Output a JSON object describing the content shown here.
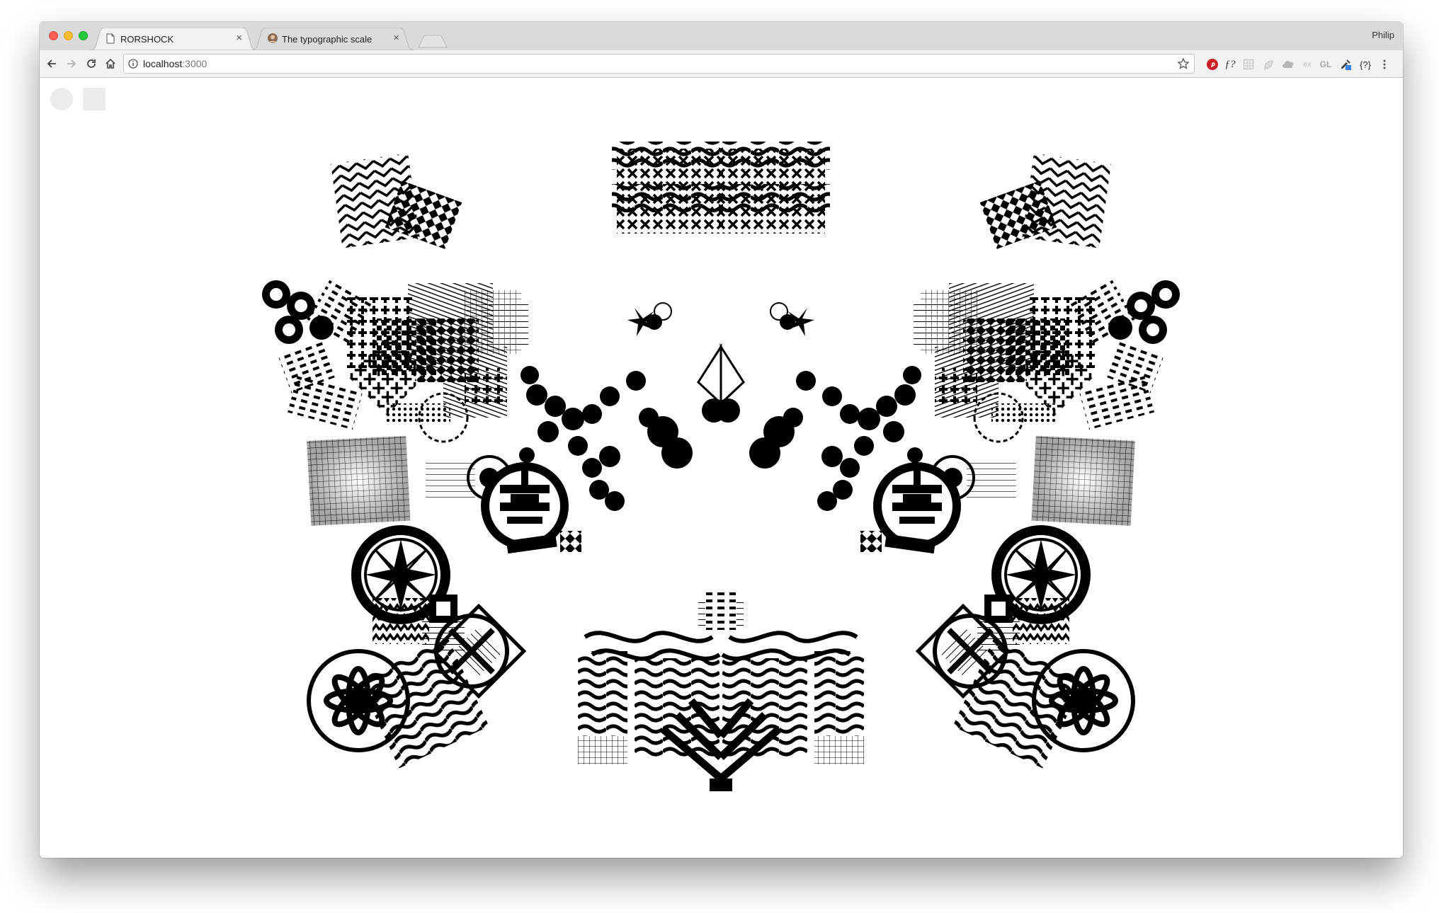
{
  "browser": {
    "tabs": [
      {
        "title": "RORSHOCK",
        "active": true,
        "favicon": "page-icon"
      },
      {
        "title": "The typographic scale",
        "active": false,
        "favicon": "avatar-icon"
      }
    ],
    "profile_name": "Philip",
    "url": {
      "host": "localhost",
      "port": ":3000"
    },
    "extensions": [
      "pinterest-icon",
      "fontface-icon",
      "grid-icon",
      "leaf-icon",
      "cloud-icon",
      "ex-icon",
      "gl-icon",
      "color-picker-icon",
      "json-icon",
      "menu-dots-icon"
    ],
    "extension_labels": {
      "fontface": "ƒ?",
      "ex": "ex",
      "gl": "GL",
      "json": "{?}"
    }
  },
  "page": {
    "controls": [
      "circle-shape-button",
      "square-shape-button"
    ],
    "artwork": "symmetric black-and-white pattern composition",
    "colors": {
      "ink": "#000000",
      "background": "#ffffff",
      "control": "#ececec"
    }
  }
}
